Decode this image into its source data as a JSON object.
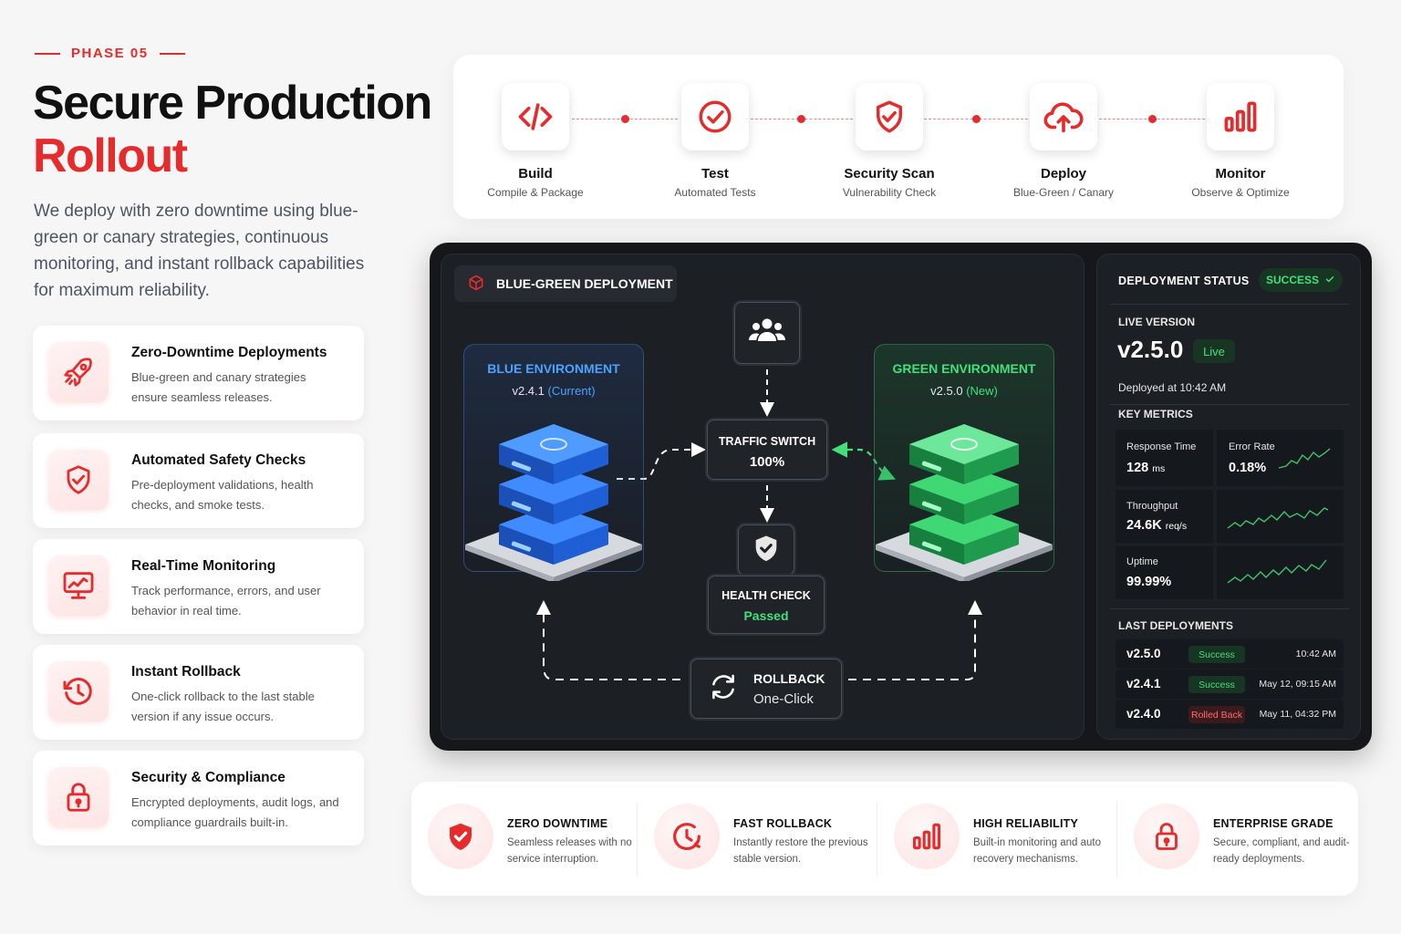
{
  "header": {
    "phase": "PHASE 05",
    "title_line1": "Secure Production",
    "title_line2": "Rollout",
    "intro": "We deploy with zero downtime using blue-green or canary strategies, continuous monitoring, and instant rollback capabilities for maximum reliability."
  },
  "features": [
    {
      "title": "Zero-Downtime Deployments",
      "desc": "Blue-green and canary strategies ensure seamless releases.",
      "icon": "rocket-icon"
    },
    {
      "title": "Automated Safety Checks",
      "desc": "Pre-deployment validations, health checks, and smoke tests.",
      "icon": "shield-check-icon"
    },
    {
      "title": "Real-Time Monitoring",
      "desc": "Track performance, errors, and user behavior in real time.",
      "icon": "monitor-chart-icon"
    },
    {
      "title": "Instant Rollback",
      "desc": "One-click rollback to the last stable version if any issue occurs.",
      "icon": "rollback-clock-icon"
    },
    {
      "title": "Security & Compliance",
      "desc": "Encrypted deployments, audit logs, and compliance guardrails built-in.",
      "icon": "lock-icon"
    }
  ],
  "pipeline": [
    {
      "name": "Build",
      "sub": "Compile & Package",
      "icon": "code-icon"
    },
    {
      "name": "Test",
      "sub": "Automated Tests",
      "icon": "check-circle-icon"
    },
    {
      "name": "Security Scan",
      "sub": "Vulnerability Check",
      "icon": "shield-check-icon"
    },
    {
      "name": "Deploy",
      "sub": "Blue-Green / Canary",
      "icon": "cloud-upload-icon"
    },
    {
      "name": "Monitor",
      "sub": "Observe & Optimize",
      "icon": "bar-chart-icon"
    }
  ],
  "diagram": {
    "tag": "BLUE-GREEN DEPLOYMENT",
    "blue": {
      "title": "BLUE ENVIRONMENT",
      "version": "v2.4.1",
      "note": "(Current)"
    },
    "green": {
      "title": "GREEN ENVIRONMENT",
      "version": "v2.5.0",
      "note": "(New)"
    },
    "traffic": {
      "label": "TRAFFIC SWITCH",
      "value": "100%"
    },
    "health": {
      "label": "HEALTH CHECK",
      "value": "Passed"
    },
    "rollback": {
      "label": "ROLLBACK",
      "value": "One-Click"
    }
  },
  "status": {
    "title": "DEPLOYMENT STATUS",
    "badge": "SUCCESS",
    "live_label": "LIVE VERSION",
    "live_version": "v2.5.0",
    "live_badge": "Live",
    "deployed": "Deployed at 10:42 AM",
    "metrics_label": "KEY METRICS",
    "metrics": {
      "response_label": "Response Time",
      "response_value": "128",
      "response_unit": "ms",
      "error_label": "Error Rate",
      "error_value": "0.18%",
      "throughput_label": "Throughput",
      "throughput_value": "24.6K",
      "throughput_unit": "req/s",
      "uptime_label": "Uptime",
      "uptime_value": "99.99%"
    },
    "last_label": "LAST DEPLOYMENTS",
    "deployments": [
      {
        "version": "v2.5.0",
        "status": "Success",
        "time": "10:42 AM"
      },
      {
        "version": "v2.4.1",
        "status": "Success",
        "time": "May 12, 09:15 AM"
      },
      {
        "version": "v2.4.0",
        "status": "Rolled Back",
        "time": "May 11, 04:32 PM"
      }
    ]
  },
  "benefits": [
    {
      "title": "ZERO DOWNTIME",
      "desc": "Seamless releases with no service interruption.",
      "icon": "shield-check-icon"
    },
    {
      "title": "FAST ROLLBACK",
      "desc": "Instantly restore the previous stable version.",
      "icon": "clock-rollback-icon"
    },
    {
      "title": "HIGH RELIABILITY",
      "desc": "Built-in monitoring and auto recovery mechanisms.",
      "icon": "bar-chart-icon"
    },
    {
      "title": "ENTERPRISE GRADE",
      "desc": "Secure, compliant, and audit-ready deployments.",
      "icon": "lock-icon"
    }
  ],
  "colors": {
    "accent": "#e52b2b",
    "blue": "#4ba3ff",
    "green": "#42e07a",
    "dark": "#15171b"
  }
}
